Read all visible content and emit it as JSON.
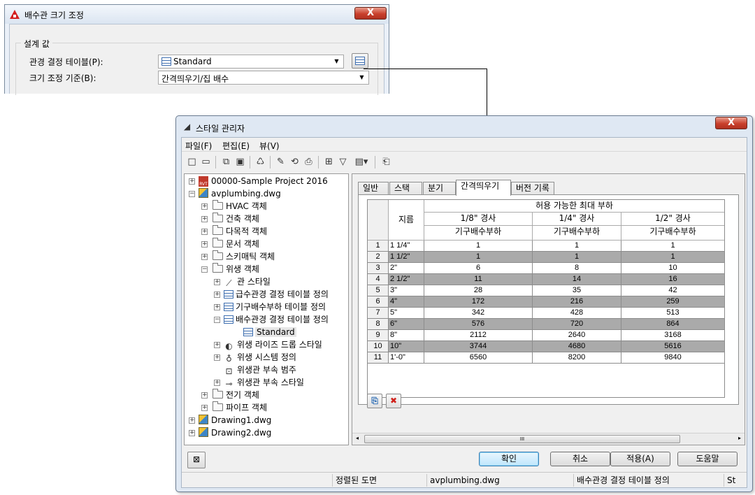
{
  "resize_dialog": {
    "title": "배수관 크기 조정",
    "close_label": "X",
    "group_label": "설계 값",
    "table_label": "관경 결정 테이블(P):",
    "table_value": "Standard",
    "criteria_label": "크기 조정 기준(B):",
    "criteria_value": "간격띄우기/집 배수"
  },
  "style_manager": {
    "title": "스타일 관리자",
    "close_label": "X",
    "menu": [
      "파일(F)",
      "편집(E)",
      "뷰(V)"
    ],
    "tree": [
      {
        "label": "00000-Sample Project 2016",
        "icon": "project-icon"
      },
      {
        "label": "avplumbing.dwg",
        "icon": "drawing-icon"
      },
      {
        "label": "HVAC 객체",
        "icon": "folder-icon"
      },
      {
        "label": "건축 객체",
        "icon": "folder-icon"
      },
      {
        "label": "다목적 객체",
        "icon": "folder-icon"
      },
      {
        "label": "문서 객체",
        "icon": "folder-icon"
      },
      {
        "label": "스키매틱 객체",
        "icon": "folder-icon"
      },
      {
        "label": "위생 객체",
        "icon": "folder-icon"
      },
      {
        "label": "관 스타일",
        "icon": "pipe-icon"
      },
      {
        "label": "급수관경 결정 테이블 정의",
        "icon": "table-icon"
      },
      {
        "label": "기구배수부하 테이블 정의",
        "icon": "table-icon"
      },
      {
        "label": "배수관경 결정 테이블 정의",
        "icon": "table-icon"
      },
      {
        "label": "Standard",
        "icon": "table-icon"
      },
      {
        "label": "위생 라이즈 드롭 스타일",
        "icon": "riser-icon"
      },
      {
        "label": "위생 시스템 정의",
        "icon": "system-icon"
      },
      {
        "label": "위생관 부속 범주",
        "icon": "category-icon"
      },
      {
        "label": "위생관 부속 스타일",
        "icon": "fitting-icon"
      },
      {
        "label": "전기 객체",
        "icon": "folder-icon"
      },
      {
        "label": "파이프 객체",
        "icon": "folder-icon"
      },
      {
        "label": "Drawing1.dwg",
        "icon": "drawing-icon"
      },
      {
        "label": "Drawing2.dwg",
        "icon": "drawing-icon"
      }
    ],
    "tabs": [
      "일반",
      "스택",
      "분기",
      "간격띄우기",
      "버전 기록"
    ],
    "active_tab": "간격띄우기",
    "table": {
      "header_top": "허용 가능한 최대 부하",
      "size_header": "지름",
      "slope_headers": [
        "1/8\" 경사",
        "1/4\" 경사",
        "1/2\" 경사"
      ],
      "unit_headers": [
        "기구배수부하",
        "기구배수부하",
        "기구배수부하"
      ],
      "rows": [
        {
          "n": "1",
          "size": "1 1/4\"",
          "v1": "1",
          "v2": "1",
          "v3": "1"
        },
        {
          "n": "2",
          "size": "1 1/2\"",
          "v1": "1",
          "v2": "1",
          "v3": "1"
        },
        {
          "n": "3",
          "size": "2\"",
          "v1": "6",
          "v2": "8",
          "v3": "10"
        },
        {
          "n": "4",
          "size": "2 1/2\"",
          "v1": "11",
          "v2": "14",
          "v3": "16"
        },
        {
          "n": "5",
          "size": "3\"",
          "v1": "28",
          "v2": "35",
          "v3": "42"
        },
        {
          "n": "6",
          "size": "4\"",
          "v1": "172",
          "v2": "216",
          "v3": "259"
        },
        {
          "n": "7",
          "size": "5\"",
          "v1": "342",
          "v2": "428",
          "v3": "513"
        },
        {
          "n": "8",
          "size": "6\"",
          "v1": "576",
          "v2": "720",
          "v3": "864"
        },
        {
          "n": "9",
          "size": "8\"",
          "v1": "2112",
          "v2": "2640",
          "v3": "3168"
        },
        {
          "n": "10",
          "size": "10\"",
          "v1": "3744",
          "v2": "4680",
          "v3": "5616"
        },
        {
          "n": "11",
          "size": "1'-0\"",
          "v1": "6560",
          "v2": "8200",
          "v3": "9840"
        }
      ]
    },
    "scroll_grip": "III",
    "buttons": {
      "ok": "확인",
      "cancel": "취소",
      "apply": "적용(A)",
      "help": "도움말"
    },
    "status": [
      "정렬된 도면",
      "avplumbing.dwg",
      "배수관경 결정 테이블 정의",
      "St"
    ],
    "colors": {
      "alt_row": "#aaaaaa",
      "close_red": "#c9402c",
      "default_button": "#3c7fb1"
    }
  }
}
